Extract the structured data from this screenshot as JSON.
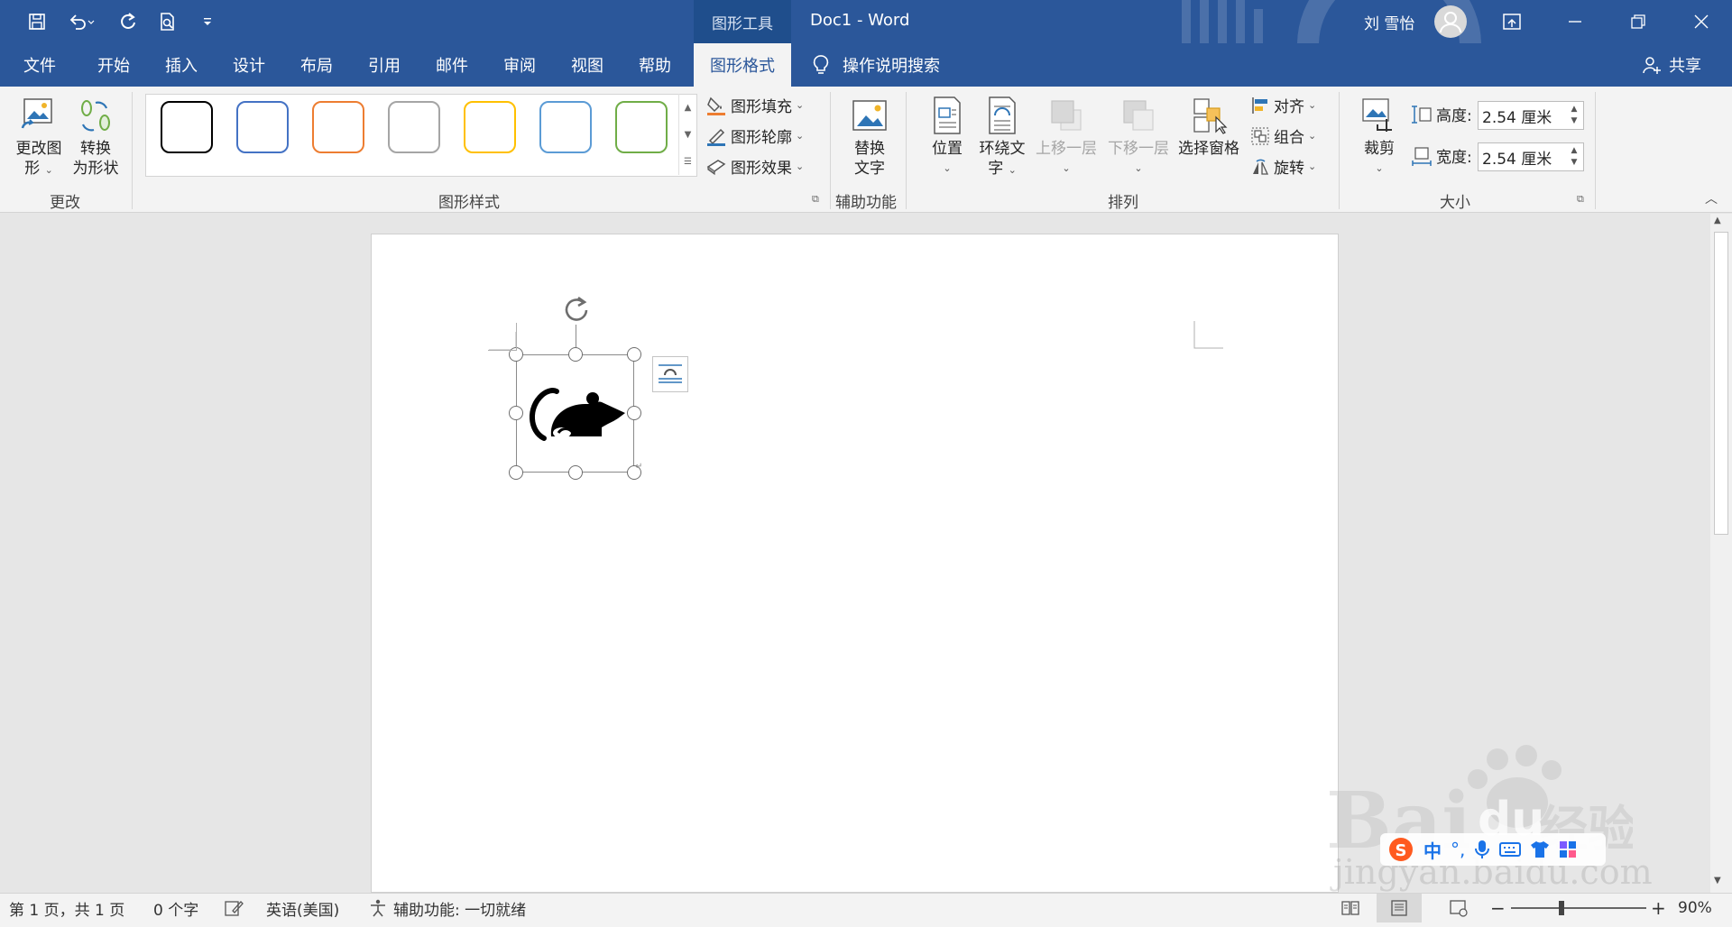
{
  "titlebar": {
    "context_tab": "图形工具",
    "doc_title": "Doc1  -  Word",
    "user_name": "刘 雪怡"
  },
  "tabs": [
    {
      "label": "文件"
    },
    {
      "label": "开始"
    },
    {
      "label": "插入"
    },
    {
      "label": "设计"
    },
    {
      "label": "布局"
    },
    {
      "label": "引用"
    },
    {
      "label": "邮件"
    },
    {
      "label": "审阅"
    },
    {
      "label": "视图"
    },
    {
      "label": "帮助"
    },
    {
      "label": "图形格式"
    }
  ],
  "tell_me": "操作说明搜索",
  "share": "共享",
  "ribbon": {
    "change": {
      "change_graphic_l1": "更改图",
      "change_graphic_l2": "形",
      "convert_l1": "转换",
      "convert_l2": "为形状",
      "label": "更改"
    },
    "styles": {
      "label": "图形样式",
      "fill": "图形填充",
      "outline": "图形轮廓",
      "effects": "图形效果",
      "swatch_colors": [
        "#000000",
        "#4472c4",
        "#ed7d31",
        "#a5a5a5",
        "#ffc000",
        "#5b9bd5",
        "#70ad47"
      ]
    },
    "accessibility": {
      "alt_text_l1": "替换",
      "alt_text_l2": "文字",
      "label": "辅助功能"
    },
    "arrange": {
      "position": "位置",
      "wrap_l1": "环绕文",
      "wrap_l2": "字",
      "bring_forward": "上移一层",
      "send_backward": "下移一层",
      "selection_pane": "选择窗格",
      "align": "对齐",
      "group": "组合",
      "rotate": "旋转",
      "label": "排列"
    },
    "size": {
      "crop": "裁剪",
      "height_label": "高度:",
      "height_value": "2.54 厘米",
      "width_label": "宽度:",
      "width_value": "2.54 厘米",
      "label": "大小"
    }
  },
  "statusbar": {
    "page": "第 1 页，共 1 页",
    "words": "0 个字",
    "language": "英语(美国)",
    "accessibility": "辅助功能: 一切就绪",
    "zoom": "90%",
    "zoom_fraction": 0.37
  },
  "watermark": {
    "main": "Bai",
    "du": "du",
    "brand": "经验",
    "sub": "jingyan.baidu.com"
  },
  "ime": {
    "mode": "中"
  },
  "colors": {
    "accent": "#2b579a",
    "ribbon": "#f3f3f3"
  }
}
